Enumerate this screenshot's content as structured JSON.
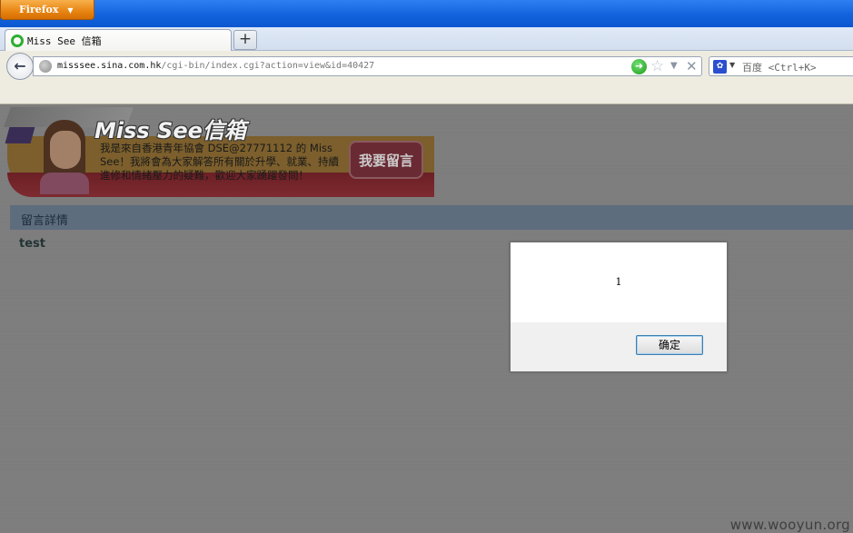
{
  "browser": {
    "menu_button": "Firefox",
    "tab_title": "Miss See 信箱",
    "new_tab_label": "+",
    "url_host": "misssee.sina.com.hk",
    "url_path": "/cgi-bin/index.cgi?action=view&id=40427",
    "search_placeholder": "百度 <Ctrl+K>"
  },
  "page": {
    "logo_text": "Miss See信箱",
    "banner_description": "我是來自香港青年協會 DSE@27771112 的 Miss See！我將會為大家解答所有關於升學、就業、持續進修和情緒壓力的疑難，歡迎大家踴躍發問！",
    "banner_button": "我要留言",
    "section_title": "留言詳情",
    "post_title": "test"
  },
  "dialog": {
    "message": "1",
    "ok_label": "确定"
  },
  "watermark": "www.wooyun.org"
}
